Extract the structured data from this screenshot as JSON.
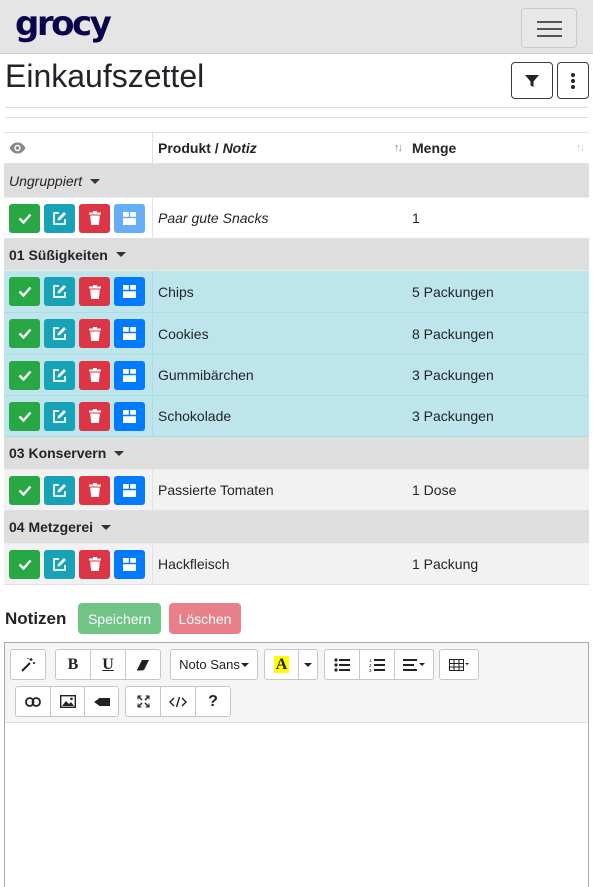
{
  "navbar": {
    "logo": "grocy"
  },
  "header": {
    "title": "Einkaufszettel"
  },
  "table": {
    "columns": {
      "product": "Produkt",
      "separator": " / ",
      "note": "Notiz",
      "amount": "Menge"
    },
    "groups": [
      {
        "name": "Ungruppiert",
        "italic": true,
        "rows": [
          {
            "product": "Paar gute Snacks",
            "amount": "1",
            "italic": true,
            "style": "white",
            "stock_disabled": true
          }
        ]
      },
      {
        "name": "01 Süßigkeiten",
        "rows": [
          {
            "product": "Chips",
            "amount": "5 Packungen",
            "style": "teal"
          },
          {
            "product": "Cookies",
            "amount": "8 Packungen",
            "style": "teal"
          },
          {
            "product": "Gummibärchen",
            "amount": "3 Packungen",
            "style": "teal"
          },
          {
            "product": "Schokolade",
            "amount": "3 Packungen",
            "style": "teal"
          }
        ]
      },
      {
        "name": "03 Konservern",
        "rows": [
          {
            "product": "Passierte Tomaten",
            "amount": "1 Dose",
            "style": "light"
          }
        ]
      },
      {
        "name": "04 Metzgerei",
        "rows": [
          {
            "product": "Hackfleisch",
            "amount": "1 Packung",
            "style": "light"
          }
        ]
      }
    ]
  },
  "notes": {
    "title": "Notizen",
    "save_label": "Speichern",
    "delete_label": "Löschen",
    "editor": {
      "font_name": "Noto Sans",
      "bold": "B",
      "underline": "U",
      "help": "?"
    }
  },
  "colors": {
    "success": "#28a745",
    "info": "#17a2b8",
    "danger": "#dc3545",
    "primary": "#007bff",
    "row_info": "#bee5eb",
    "group_bg": "#dedede",
    "logo": "#0b024c"
  }
}
